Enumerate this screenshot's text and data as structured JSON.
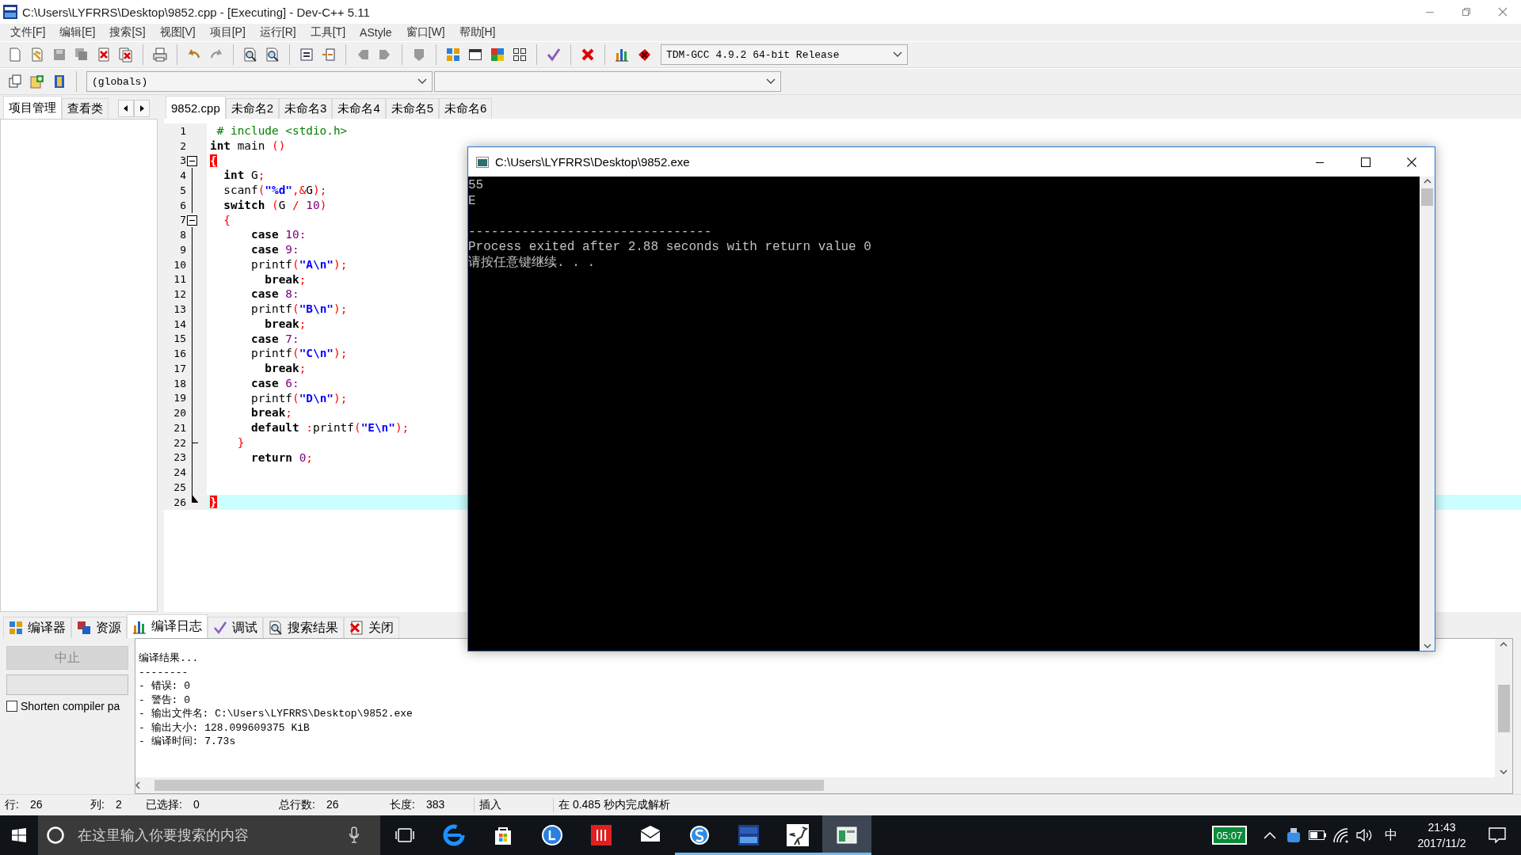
{
  "window": {
    "title": "C:\\Users\\LYFRRS\\Desktop\\9852.cpp - [Executing] - Dev-C++ 5.11"
  },
  "menu": [
    "文件[F]",
    "编辑[E]",
    "搜索[S]",
    "视图[V]",
    "项目[P]",
    "运行[R]",
    "工具[T]",
    "AStyle",
    "窗口[W]",
    "帮助[H]"
  ],
  "compiler_select": {
    "value": "TDM-GCC 4.9.2 64-bit Release"
  },
  "scope_select": {
    "value": "(globals)"
  },
  "left_tabs": [
    {
      "label": "项目管理",
      "selected": true
    },
    {
      "label": "查看类",
      "selected": false
    }
  ],
  "editor_tabs": [
    {
      "label": "9852.cpp",
      "selected": true
    },
    {
      "label": "未命名2",
      "selected": false
    },
    {
      "label": "未命名3",
      "selected": false
    },
    {
      "label": "未命名4",
      "selected": false
    },
    {
      "label": "未命名5",
      "selected": false
    },
    {
      "label": "未命名6",
      "selected": false
    }
  ],
  "editor": {
    "lines": [
      {
        "number": "1",
        "kind": "plain",
        "current": false,
        "segments": [
          {
            "kind": "preprocessor",
            "text": " # include <stdio.h>"
          }
        ]
      },
      {
        "number": "2",
        "kind": "plain",
        "current": false,
        "segments": [
          {
            "kind": "keyword",
            "text": "int"
          },
          {
            "kind": "plain",
            "text": " main "
          },
          {
            "kind": "symbol",
            "text": "()"
          }
        ]
      },
      {
        "number": "3",
        "kind": "fold_start",
        "current": false,
        "segments": [
          {
            "kind": "match",
            "text": "{"
          }
        ]
      },
      {
        "number": "4",
        "kind": "plain",
        "current": false,
        "segments": [
          {
            "kind": "keyword",
            "text": "  int"
          },
          {
            "kind": "plain",
            "text": " G"
          },
          {
            "kind": "symbol",
            "text": ";"
          }
        ]
      },
      {
        "number": "5",
        "kind": "plain",
        "current": false,
        "segments": [
          {
            "kind": "plain",
            "text": "  scanf"
          },
          {
            "kind": "symbol",
            "text": "("
          },
          {
            "kind": "string",
            "text": "\"%d\""
          },
          {
            "kind": "symbol",
            "text": ",&"
          },
          {
            "kind": "plain",
            "text": "G"
          },
          {
            "kind": "symbol",
            "text": ");"
          }
        ]
      },
      {
        "number": "6",
        "kind": "plain",
        "current": false,
        "segments": [
          {
            "kind": "keyword",
            "text": "  switch"
          },
          {
            "kind": "symbol",
            "text": " ("
          },
          {
            "kind": "plain",
            "text": "G "
          },
          {
            "kind": "symbol",
            "text": "/"
          },
          {
            "kind": "number",
            "text": " 10"
          },
          {
            "kind": "symbol",
            "text": ")"
          }
        ]
      },
      {
        "number": "7",
        "kind": "fold_start",
        "current": false,
        "segments": [
          {
            "kind": "symbol",
            "text": "  {"
          }
        ]
      },
      {
        "number": "8",
        "kind": "plain",
        "current": false,
        "segments": [
          {
            "kind": "keyword",
            "text": "      case"
          },
          {
            "kind": "number",
            "text": " 10:"
          }
        ]
      },
      {
        "number": "9",
        "kind": "plain",
        "current": false,
        "segments": [
          {
            "kind": "keyword",
            "text": "      case"
          },
          {
            "kind": "number",
            "text": " 9:"
          }
        ]
      },
      {
        "number": "10",
        "kind": "plain",
        "current": false,
        "segments": [
          {
            "kind": "plain",
            "text": "      printf"
          },
          {
            "kind": "symbol",
            "text": "("
          },
          {
            "kind": "string",
            "text": "\"A\\n\""
          },
          {
            "kind": "symbol",
            "text": ");"
          }
        ]
      },
      {
        "number": "11",
        "kind": "plain",
        "current": false,
        "segments": [
          {
            "kind": "keyword",
            "text": "        break"
          },
          {
            "kind": "symbol",
            "text": ";"
          }
        ]
      },
      {
        "number": "12",
        "kind": "plain",
        "current": false,
        "segments": [
          {
            "kind": "keyword",
            "text": "      case"
          },
          {
            "kind": "number",
            "text": " 8:"
          }
        ]
      },
      {
        "number": "13",
        "kind": "plain",
        "current": false,
        "segments": [
          {
            "kind": "plain",
            "text": "      printf"
          },
          {
            "kind": "symbol",
            "text": "("
          },
          {
            "kind": "string",
            "text": "\"B\\n\""
          },
          {
            "kind": "symbol",
            "text": ");"
          }
        ]
      },
      {
        "number": "14",
        "kind": "plain",
        "current": false,
        "segments": [
          {
            "kind": "keyword",
            "text": "        break"
          },
          {
            "kind": "symbol",
            "text": ";"
          }
        ]
      },
      {
        "number": "15",
        "kind": "plain",
        "current": false,
        "segments": [
          {
            "kind": "keyword",
            "text": "      case"
          },
          {
            "kind": "number",
            "text": " 7:"
          }
        ]
      },
      {
        "number": "16",
        "kind": "plain",
        "current": false,
        "segments": [
          {
            "kind": "plain",
            "text": "      printf"
          },
          {
            "kind": "symbol",
            "text": "("
          },
          {
            "kind": "string",
            "text": "\"C\\n\""
          },
          {
            "kind": "symbol",
            "text": ");"
          }
        ]
      },
      {
        "number": "17",
        "kind": "plain",
        "current": false,
        "segments": [
          {
            "kind": "keyword",
            "text": "        break"
          },
          {
            "kind": "symbol",
            "text": ";"
          }
        ]
      },
      {
        "number": "18",
        "kind": "plain",
        "current": false,
        "segments": [
          {
            "kind": "keyword",
            "text": "      case"
          },
          {
            "kind": "number",
            "text": " 6:"
          }
        ]
      },
      {
        "number": "19",
        "kind": "plain",
        "current": false,
        "segments": [
          {
            "kind": "plain",
            "text": "      printf"
          },
          {
            "kind": "symbol",
            "text": "("
          },
          {
            "kind": "string",
            "text": "\"D\\n\""
          },
          {
            "kind": "symbol",
            "text": ");"
          }
        ]
      },
      {
        "number": "20",
        "kind": "plain",
        "current": false,
        "segments": [
          {
            "kind": "keyword",
            "text": "      break"
          },
          {
            "kind": "symbol",
            "text": ";"
          }
        ]
      },
      {
        "number": "21",
        "kind": "plain",
        "current": false,
        "segments": [
          {
            "kind": "keyword",
            "text": "      default"
          },
          {
            "kind": "symbol",
            "text": " :"
          },
          {
            "kind": "plain",
            "text": "printf"
          },
          {
            "kind": "symbol",
            "text": "("
          },
          {
            "kind": "string",
            "text": "\"E\\n\""
          },
          {
            "kind": "symbol",
            "text": ");"
          }
        ]
      },
      {
        "number": "22",
        "kind": "fold_end",
        "current": false,
        "segments": [
          {
            "kind": "symbol",
            "text": "    }"
          }
        ]
      },
      {
        "number": "23",
        "kind": "plain",
        "current": false,
        "segments": [
          {
            "kind": "keyword",
            "text": "      return"
          },
          {
            "kind": "number",
            "text": " 0"
          },
          {
            "kind": "symbol",
            "text": ";"
          }
        ]
      },
      {
        "number": "24",
        "kind": "plain",
        "current": false
      },
      {
        "number": "25",
        "kind": "plain",
        "current": false
      },
      {
        "number": "26",
        "kind": "fold_end",
        "current": true,
        "segments": [
          {
            "kind": "match",
            "text": "}"
          }
        ]
      }
    ]
  },
  "console": {
    "title": "C:\\Users\\LYFRRS\\Desktop\\9852.exe",
    "output": [
      "55",
      "E"
    ],
    "footer": [
      "--------------------------------",
      "Process exited after 2.88 seconds with return value 0",
      "请按任意键继续. . ."
    ]
  },
  "bottom_tabs": [
    {
      "label": "编译器",
      "selected": false
    },
    {
      "label": "资源",
      "selected": false
    },
    {
      "label": "编译日志",
      "selected": true
    },
    {
      "label": "调试",
      "selected": false
    },
    {
      "label": "搜索结果",
      "selected": false
    },
    {
      "label": "关闭",
      "selected": false
    }
  ],
  "compile_panel": {
    "abort_button": {
      "label": "中止",
      "disabled": true
    },
    "progress": {
      "level": 0
    },
    "shorten_checkbox": {
      "label": "Shorten compiler pa",
      "checked": false
    },
    "log_lines": [
      "编译结果...",
      "--------",
      "- 错误: 0",
      "- 警告: 0",
      "- 输出文件名: C:\\Users\\LYFRRS\\Desktop\\9852.exe",
      "- 输出大小: 128.099609375 KiB",
      "- 编译时间: 7.73s"
    ]
  },
  "status_bar": [
    {
      "label": "行:",
      "value": "26"
    },
    {
      "label": "列:",
      "value": "2"
    },
    {
      "label": "已选择:",
      "value": "0"
    },
    {
      "label": "总行数:",
      "value": "26"
    },
    {
      "label": "长度:",
      "value": "383"
    },
    {
      "value": "插入"
    },
    {
      "value": "在 0.485 秒内完成解析"
    }
  ],
  "taskbar": {
    "search": {
      "placeholder": "在这里输入你要搜索的内容"
    },
    "apps": [
      {
        "running": false,
        "selected": false
      },
      {
        "running": false,
        "selected": false
      },
      {
        "running": false,
        "selected": false
      },
      {
        "running": false,
        "selected": false
      },
      {
        "running": false,
        "selected": false
      },
      {
        "running": true,
        "selected": false
      },
      {
        "running": true,
        "selected": false
      },
      {
        "running": true,
        "selected": false
      },
      {
        "running": true,
        "selected": true
      }
    ],
    "battery_timer": "05:07",
    "ime": "中",
    "time": "21:43",
    "date": "2017/11/2"
  }
}
